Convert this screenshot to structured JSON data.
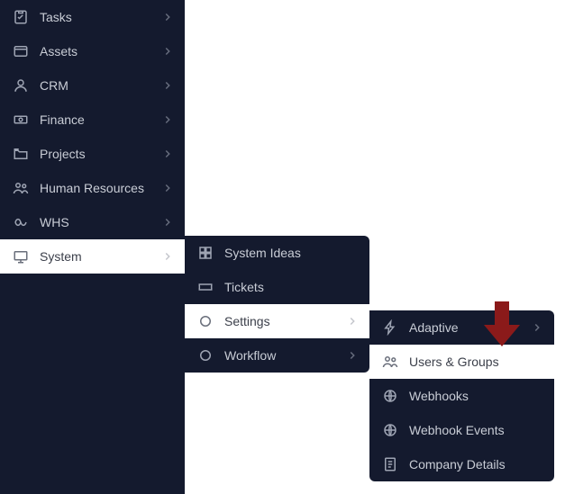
{
  "colors": {
    "panel": "#141a2e",
    "text": "#c9cdd6",
    "selectedBg": "#ffffff",
    "selectedText": "#3b3f4a",
    "arrow": "#8b1a1a"
  },
  "sidebar": {
    "items": [
      {
        "label": "Tasks",
        "icon": "tasks-icon"
      },
      {
        "label": "Assets",
        "icon": "assets-icon"
      },
      {
        "label": "CRM",
        "icon": "crm-icon"
      },
      {
        "label": "Finance",
        "icon": "finance-icon"
      },
      {
        "label": "Projects",
        "icon": "projects-icon"
      },
      {
        "label": "Human Resources",
        "icon": "hr-icon"
      },
      {
        "label": "WHS",
        "icon": "whs-icon"
      },
      {
        "label": "System",
        "icon": "system-icon",
        "selected": true
      }
    ]
  },
  "flyout_system": {
    "items": [
      {
        "label": "System Ideas",
        "icon": "grid-icon",
        "hasChildren": false
      },
      {
        "label": "Tickets",
        "icon": "ticket-icon",
        "hasChildren": false
      },
      {
        "label": "Settings",
        "icon": "circle-icon",
        "hasChildren": true,
        "selected": true
      },
      {
        "label": "Workflow",
        "icon": "circle-icon",
        "hasChildren": true
      }
    ]
  },
  "flyout_settings": {
    "items": [
      {
        "label": "Adaptive",
        "icon": "bolt-icon",
        "hasChildren": true
      },
      {
        "label": "Users & Groups",
        "icon": "users-icon",
        "hasChildren": false,
        "selected": true
      },
      {
        "label": "Webhooks",
        "icon": "globe-icon",
        "hasChildren": false
      },
      {
        "label": "Webhook Events",
        "icon": "globe-icon",
        "hasChildren": false
      },
      {
        "label": "Company Details",
        "icon": "doc-icon",
        "hasChildren": false
      }
    ]
  },
  "annotation": {
    "type": "arrow-down",
    "color": "#8b1a1a"
  }
}
